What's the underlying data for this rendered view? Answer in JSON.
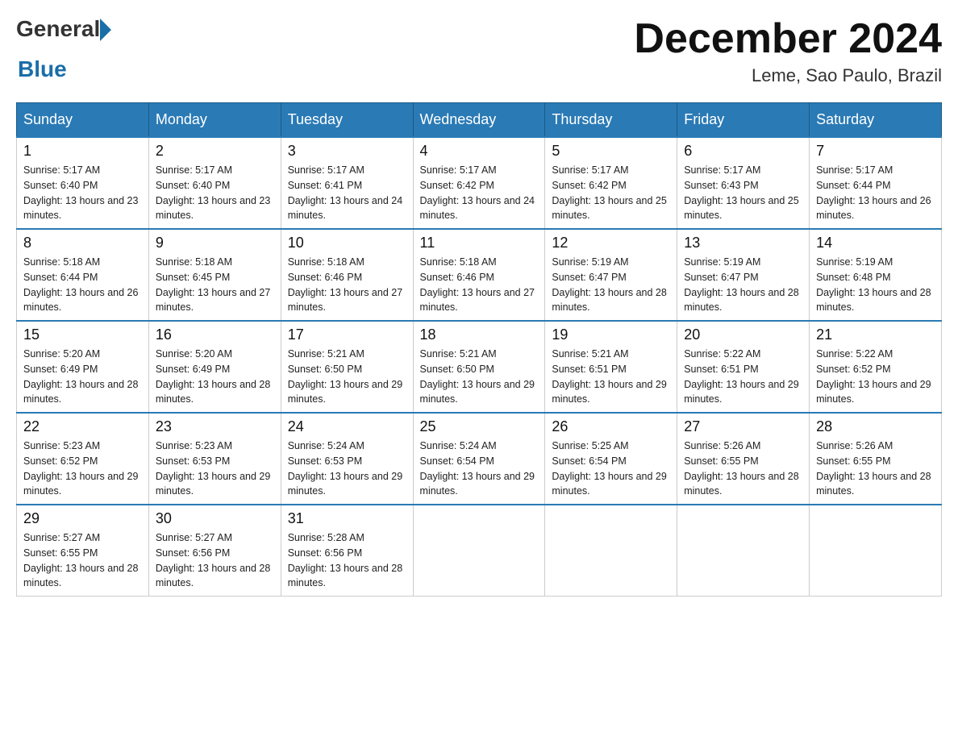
{
  "logo": {
    "general": "General",
    "blue": "Blue"
  },
  "title": "December 2024",
  "location": "Leme, Sao Paulo, Brazil",
  "days_of_week": [
    "Sunday",
    "Monday",
    "Tuesday",
    "Wednesday",
    "Thursday",
    "Friday",
    "Saturday"
  ],
  "weeks": [
    [
      {
        "day": "1",
        "sunrise": "5:17 AM",
        "sunset": "6:40 PM",
        "daylight": "13 hours and 23 minutes."
      },
      {
        "day": "2",
        "sunrise": "5:17 AM",
        "sunset": "6:40 PM",
        "daylight": "13 hours and 23 minutes."
      },
      {
        "day": "3",
        "sunrise": "5:17 AM",
        "sunset": "6:41 PM",
        "daylight": "13 hours and 24 minutes."
      },
      {
        "day": "4",
        "sunrise": "5:17 AM",
        "sunset": "6:42 PM",
        "daylight": "13 hours and 24 minutes."
      },
      {
        "day": "5",
        "sunrise": "5:17 AM",
        "sunset": "6:42 PM",
        "daylight": "13 hours and 25 minutes."
      },
      {
        "day": "6",
        "sunrise": "5:17 AM",
        "sunset": "6:43 PM",
        "daylight": "13 hours and 25 minutes."
      },
      {
        "day": "7",
        "sunrise": "5:17 AM",
        "sunset": "6:44 PM",
        "daylight": "13 hours and 26 minutes."
      }
    ],
    [
      {
        "day": "8",
        "sunrise": "5:18 AM",
        "sunset": "6:44 PM",
        "daylight": "13 hours and 26 minutes."
      },
      {
        "day": "9",
        "sunrise": "5:18 AM",
        "sunset": "6:45 PM",
        "daylight": "13 hours and 27 minutes."
      },
      {
        "day": "10",
        "sunrise": "5:18 AM",
        "sunset": "6:46 PM",
        "daylight": "13 hours and 27 minutes."
      },
      {
        "day": "11",
        "sunrise": "5:18 AM",
        "sunset": "6:46 PM",
        "daylight": "13 hours and 27 minutes."
      },
      {
        "day": "12",
        "sunrise": "5:19 AM",
        "sunset": "6:47 PM",
        "daylight": "13 hours and 28 minutes."
      },
      {
        "day": "13",
        "sunrise": "5:19 AM",
        "sunset": "6:47 PM",
        "daylight": "13 hours and 28 minutes."
      },
      {
        "day": "14",
        "sunrise": "5:19 AM",
        "sunset": "6:48 PM",
        "daylight": "13 hours and 28 minutes."
      }
    ],
    [
      {
        "day": "15",
        "sunrise": "5:20 AM",
        "sunset": "6:49 PM",
        "daylight": "13 hours and 28 minutes."
      },
      {
        "day": "16",
        "sunrise": "5:20 AM",
        "sunset": "6:49 PM",
        "daylight": "13 hours and 28 minutes."
      },
      {
        "day": "17",
        "sunrise": "5:21 AM",
        "sunset": "6:50 PM",
        "daylight": "13 hours and 29 minutes."
      },
      {
        "day": "18",
        "sunrise": "5:21 AM",
        "sunset": "6:50 PM",
        "daylight": "13 hours and 29 minutes."
      },
      {
        "day": "19",
        "sunrise": "5:21 AM",
        "sunset": "6:51 PM",
        "daylight": "13 hours and 29 minutes."
      },
      {
        "day": "20",
        "sunrise": "5:22 AM",
        "sunset": "6:51 PM",
        "daylight": "13 hours and 29 minutes."
      },
      {
        "day": "21",
        "sunrise": "5:22 AM",
        "sunset": "6:52 PM",
        "daylight": "13 hours and 29 minutes."
      }
    ],
    [
      {
        "day": "22",
        "sunrise": "5:23 AM",
        "sunset": "6:52 PM",
        "daylight": "13 hours and 29 minutes."
      },
      {
        "day": "23",
        "sunrise": "5:23 AM",
        "sunset": "6:53 PM",
        "daylight": "13 hours and 29 minutes."
      },
      {
        "day": "24",
        "sunrise": "5:24 AM",
        "sunset": "6:53 PM",
        "daylight": "13 hours and 29 minutes."
      },
      {
        "day": "25",
        "sunrise": "5:24 AM",
        "sunset": "6:54 PM",
        "daylight": "13 hours and 29 minutes."
      },
      {
        "day": "26",
        "sunrise": "5:25 AM",
        "sunset": "6:54 PM",
        "daylight": "13 hours and 29 minutes."
      },
      {
        "day": "27",
        "sunrise": "5:26 AM",
        "sunset": "6:55 PM",
        "daylight": "13 hours and 28 minutes."
      },
      {
        "day": "28",
        "sunrise": "5:26 AM",
        "sunset": "6:55 PM",
        "daylight": "13 hours and 28 minutes."
      }
    ],
    [
      {
        "day": "29",
        "sunrise": "5:27 AM",
        "sunset": "6:55 PM",
        "daylight": "13 hours and 28 minutes."
      },
      {
        "day": "30",
        "sunrise": "5:27 AM",
        "sunset": "6:56 PM",
        "daylight": "13 hours and 28 minutes."
      },
      {
        "day": "31",
        "sunrise": "5:28 AM",
        "sunset": "6:56 PM",
        "daylight": "13 hours and 28 minutes."
      },
      null,
      null,
      null,
      null
    ]
  ]
}
